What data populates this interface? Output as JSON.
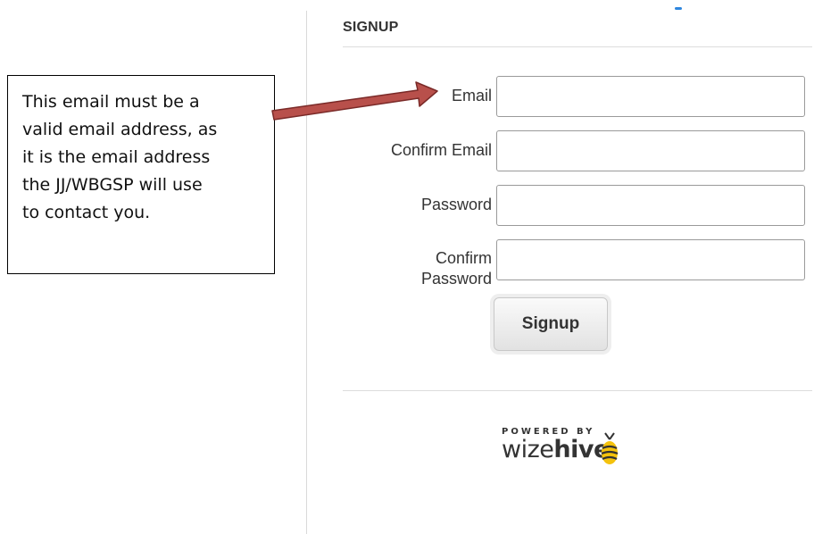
{
  "signup": {
    "title": "SIGNUP",
    "fields": [
      {
        "label": "Email",
        "value": "",
        "type": "email"
      },
      {
        "label": "Confirm Email",
        "value": "",
        "type": "email"
      },
      {
        "label": "Password",
        "value": "",
        "type": "password"
      },
      {
        "label_line1": "Confirm",
        "label_line2": "Password",
        "value": "",
        "type": "password"
      }
    ],
    "button_label": "Signup"
  },
  "callout": {
    "lines": [
      "This email must be a",
      "valid email address, as",
      "it is the email address",
      "the JJ/WBGSP will use",
      "to contact you."
    ]
  },
  "footer": {
    "powered_by": "POWERED BY",
    "brand_prefix": "wize",
    "brand_suffix": "hive"
  },
  "colors": {
    "arrow_fill": "#b8504b",
    "arrow_stroke": "#7a2a28",
    "accent_blue": "#2e86de",
    "bee_yellow": "#f4c20d"
  },
  "icons": {
    "arrow": "right-arrow-icon",
    "logo": "wizehive-bee-icon"
  }
}
